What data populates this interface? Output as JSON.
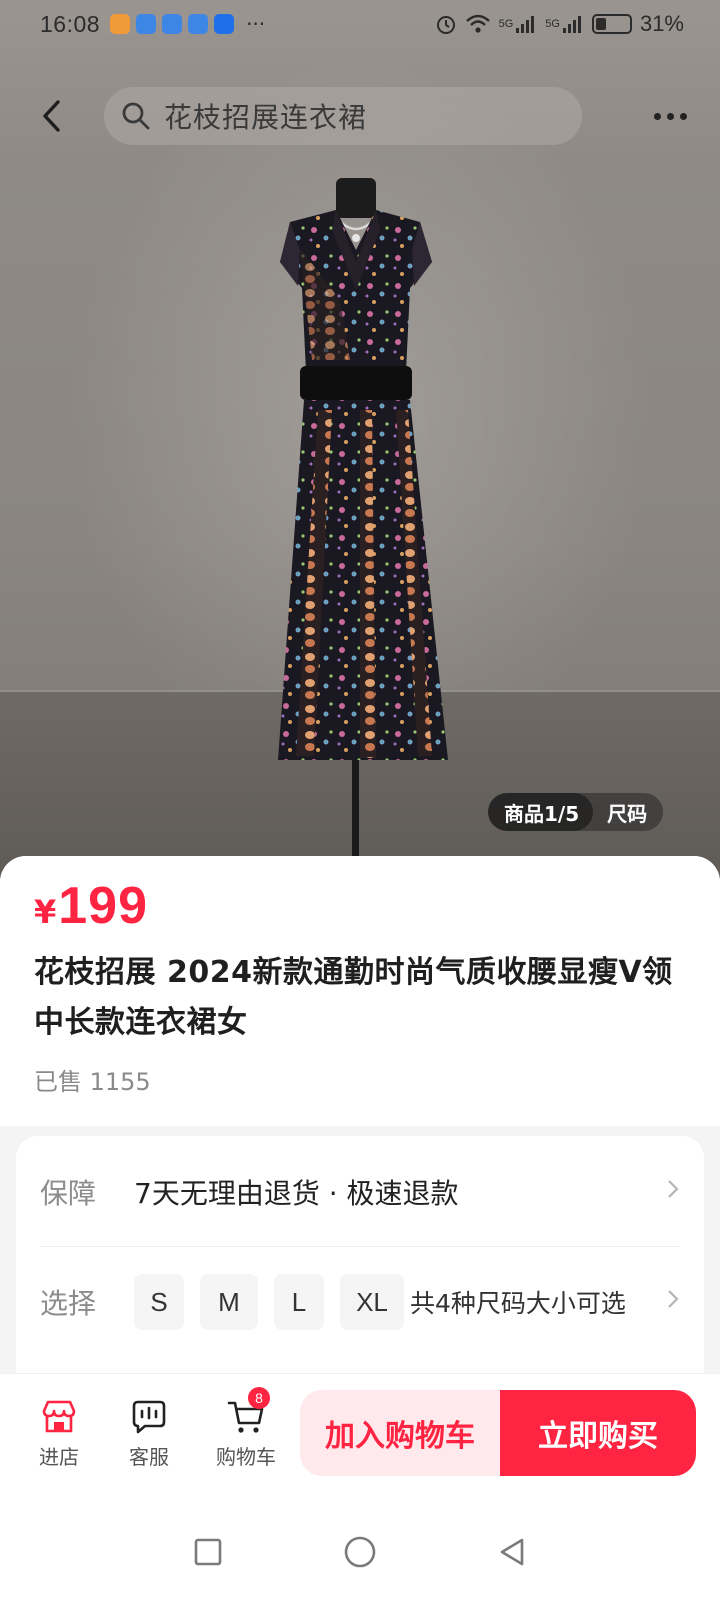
{
  "status_bar": {
    "time": "16:08",
    "more": "···",
    "battery": "31%",
    "network1": "5G",
    "network2": "5G"
  },
  "nav": {
    "search_text": "花枝招展连衣裙"
  },
  "gallery": {
    "counter": "商品1/5",
    "size_tab": "尺码"
  },
  "product": {
    "currency": "¥",
    "price": "199",
    "title": "花枝招展 2024新款通勤时尚气质收腰显瘦V领中长款连衣裙女",
    "sold": "已售 1155"
  },
  "specs": {
    "guarantee_label": "保障",
    "guarantee_value": "7天无理由退货 · 极速退款",
    "select_label": "选择",
    "sizes": [
      "S",
      "M",
      "L",
      "XL"
    ],
    "size_summary": "共4种尺码大小可选"
  },
  "action_bar": {
    "store_label": "进店",
    "service_label": "客服",
    "cart_label": "购物车",
    "cart_count": "8",
    "add_to_cart": "加入购物车",
    "buy_now": "立即购买"
  },
  "colors": {
    "accent": "#ff2442",
    "accent_light": "#ffe9ec"
  }
}
